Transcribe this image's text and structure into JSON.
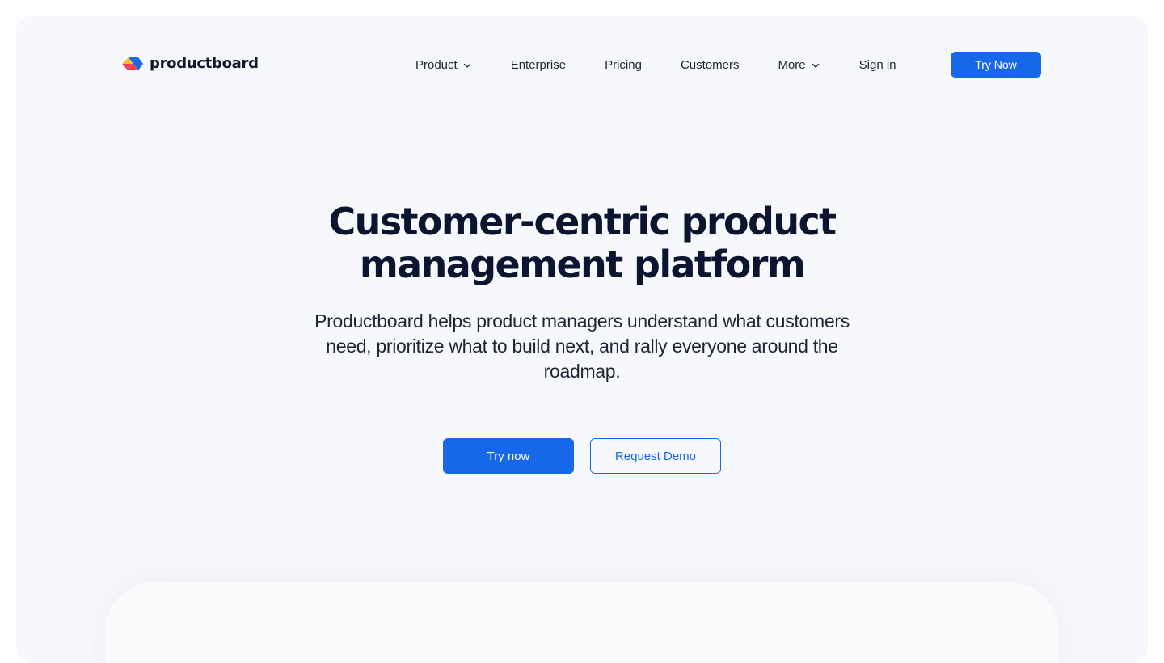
{
  "brand": {
    "name": "productboard",
    "colors": [
      "#f43f5e",
      "#fbbf24",
      "#1668e9"
    ]
  },
  "nav": {
    "items": [
      {
        "label": "Product",
        "has_dropdown": true
      },
      {
        "label": "Enterprise",
        "has_dropdown": false
      },
      {
        "label": "Pricing",
        "has_dropdown": false
      },
      {
        "label": "Customers",
        "has_dropdown": false
      },
      {
        "label": "More",
        "has_dropdown": true
      },
      {
        "label": "Sign in",
        "has_dropdown": false
      }
    ],
    "cta_label": "Try Now"
  },
  "hero": {
    "title_line1": "Customer-centric product",
    "title_line2": "management platform",
    "subtitle_line1": "Productboard helps product managers understand what customers",
    "subtitle_line2": "need, prioritize what to build next, and rally everyone around the",
    "subtitle_line3": "roadmap.",
    "primary_cta": "Try now",
    "secondary_cta": "Request Demo"
  },
  "colors": {
    "accent": "#1668e9",
    "background": "#f7f8fb",
    "heading": "#0b1530"
  }
}
